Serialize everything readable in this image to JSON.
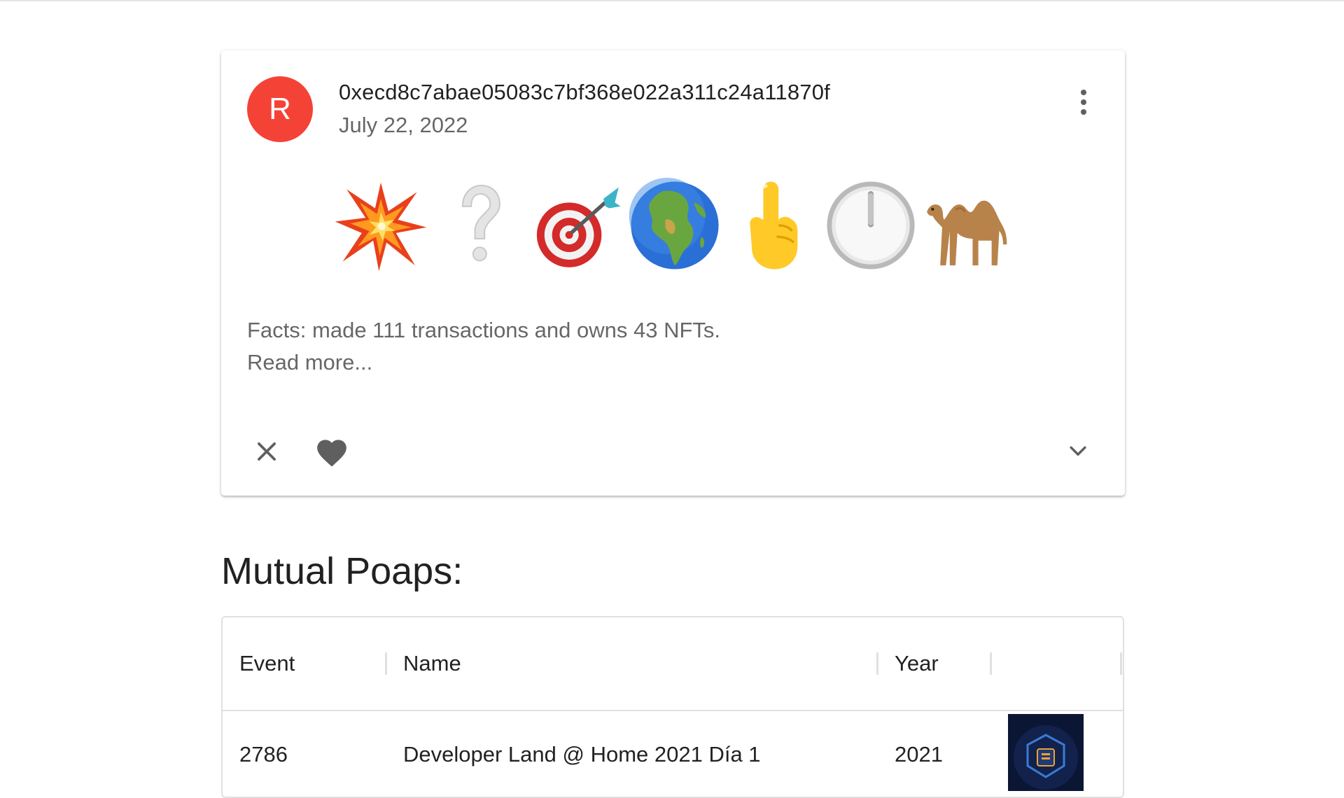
{
  "card": {
    "avatar_letter": "R",
    "address": "0xecd8c7abae05083c7bf368e022a311c24a11870f",
    "date": "July 22, 2022",
    "emojis": [
      "collision",
      "white-question-mark",
      "direct-hit",
      "globe-africa",
      "pointing-up",
      "clock-12",
      "camel"
    ],
    "facts": "Facts: made 111 transactions and owns 43 NFTs.",
    "read_more": "Read more..."
  },
  "mutual": {
    "title": "Mutual Poaps:",
    "columns": [
      "Event",
      "Name",
      "Year"
    ],
    "rows": [
      {
        "event": "2786",
        "name": "Developer Land @ Home 2021 Día 1",
        "year": "2021"
      }
    ]
  },
  "colors": {
    "avatar": "#f44336",
    "icon": "#5f5f5f"
  }
}
